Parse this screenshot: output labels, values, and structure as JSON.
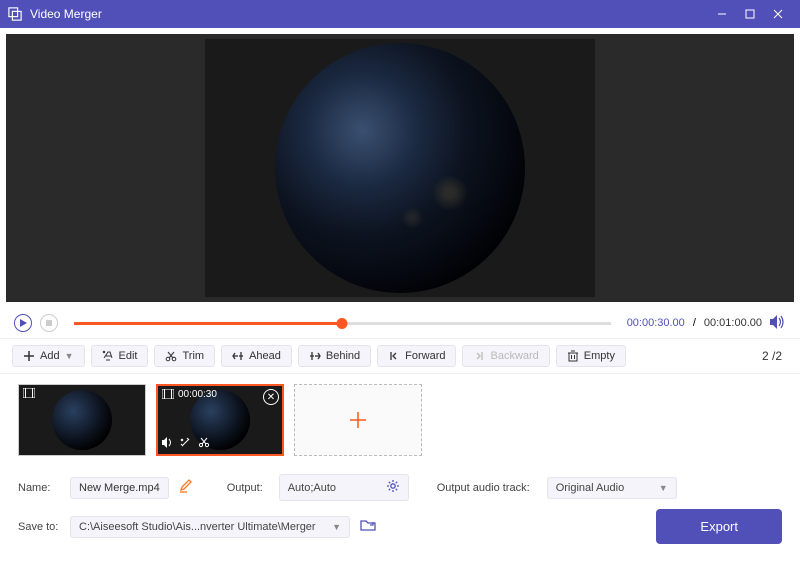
{
  "app": {
    "title": "Video Merger"
  },
  "playback": {
    "current_time": "00:00:30.00",
    "total_time": "00:01:00.00",
    "progress_percent": 50
  },
  "toolbar": {
    "add": "Add",
    "edit": "Edit",
    "trim": "Trim",
    "ahead": "Ahead",
    "behind": "Behind",
    "forward": "Forward",
    "backward": "Backward",
    "empty": "Empty"
  },
  "pager": {
    "current": "2",
    "total": "2"
  },
  "clips": {
    "selected_time": "00:00:30"
  },
  "output": {
    "name_label": "Name:",
    "name_value": "New Merge.mp4",
    "output_label": "Output:",
    "output_value": "Auto;Auto",
    "audio_label": "Output audio track:",
    "audio_value": "Original Audio",
    "saveto_label": "Save to:",
    "saveto_value": "C:\\Aiseesoft Studio\\Ais...nverter Ultimate\\Merger",
    "export_label": "Export"
  }
}
